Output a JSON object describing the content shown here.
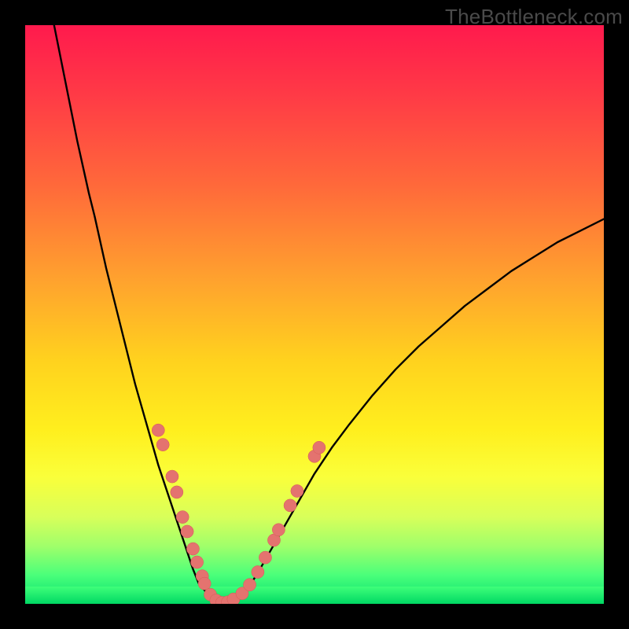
{
  "watermark": "TheBottleneck.com",
  "colors": {
    "frame": "#000000",
    "curve": "#000000",
    "marker_fill": "#e4736f",
    "marker_stroke": "#d65a56",
    "gradient_top": "#ff1a4d",
    "gradient_bottom": "#00e070"
  },
  "chart_data": {
    "type": "line",
    "title": "",
    "xlabel": "",
    "ylabel": "",
    "xlim": [
      0,
      100
    ],
    "ylim": [
      0,
      100
    ],
    "grid": false,
    "series": [
      {
        "name": "bottleneck-curve",
        "x": [
          5,
          6,
          7,
          8,
          9,
          10,
          11,
          12,
          13,
          14,
          15,
          16,
          17,
          18,
          19,
          20,
          21,
          22,
          23,
          24,
          25,
          26,
          27,
          28,
          29,
          30,
          32,
          34,
          36,
          38,
          40,
          42,
          44,
          46,
          48,
          50,
          53,
          56,
          60,
          64,
          68,
          72,
          76,
          80,
          84,
          88,
          92,
          96,
          100
        ],
        "values": [
          100,
          95,
          90,
          85,
          80,
          75.5,
          71,
          67,
          62.5,
          58,
          54,
          50,
          46,
          42,
          38,
          34.5,
          31,
          27.5,
          24,
          21,
          18,
          15,
          12,
          9,
          6,
          3.5,
          1.2,
          0.2,
          0.5,
          2,
          5,
          8.5,
          12,
          15.5,
          19,
          22.5,
          27,
          31,
          36,
          40.5,
          44.5,
          48,
          51.5,
          54.5,
          57.5,
          60,
          62.5,
          64.5,
          66.5
        ]
      }
    ],
    "markers": [
      {
        "x": 23.0,
        "y": 30.0
      },
      {
        "x": 23.8,
        "y": 27.5
      },
      {
        "x": 25.4,
        "y": 22.0
      },
      {
        "x": 26.2,
        "y": 19.3
      },
      {
        "x": 27.2,
        "y": 15.0
      },
      {
        "x": 28.0,
        "y": 12.5
      },
      {
        "x": 29.0,
        "y": 9.5
      },
      {
        "x": 29.7,
        "y": 7.2
      },
      {
        "x": 30.6,
        "y": 4.8
      },
      {
        "x": 31.0,
        "y": 3.5
      },
      {
        "x": 32.0,
        "y": 1.6
      },
      {
        "x": 33.0,
        "y": 0.6
      },
      {
        "x": 34.0,
        "y": 0.2
      },
      {
        "x": 35.0,
        "y": 0.3
      },
      {
        "x": 36.0,
        "y": 0.8
      },
      {
        "x": 37.5,
        "y": 1.8
      },
      {
        "x": 38.8,
        "y": 3.3
      },
      {
        "x": 40.2,
        "y": 5.5
      },
      {
        "x": 41.5,
        "y": 8.0
      },
      {
        "x": 43.0,
        "y": 11.0
      },
      {
        "x": 43.8,
        "y": 12.8
      },
      {
        "x": 45.8,
        "y": 17.0
      },
      {
        "x": 47.0,
        "y": 19.5
      },
      {
        "x": 50.0,
        "y": 25.5
      },
      {
        "x": 50.8,
        "y": 27.0
      }
    ],
    "marker_radius": 1.1
  }
}
